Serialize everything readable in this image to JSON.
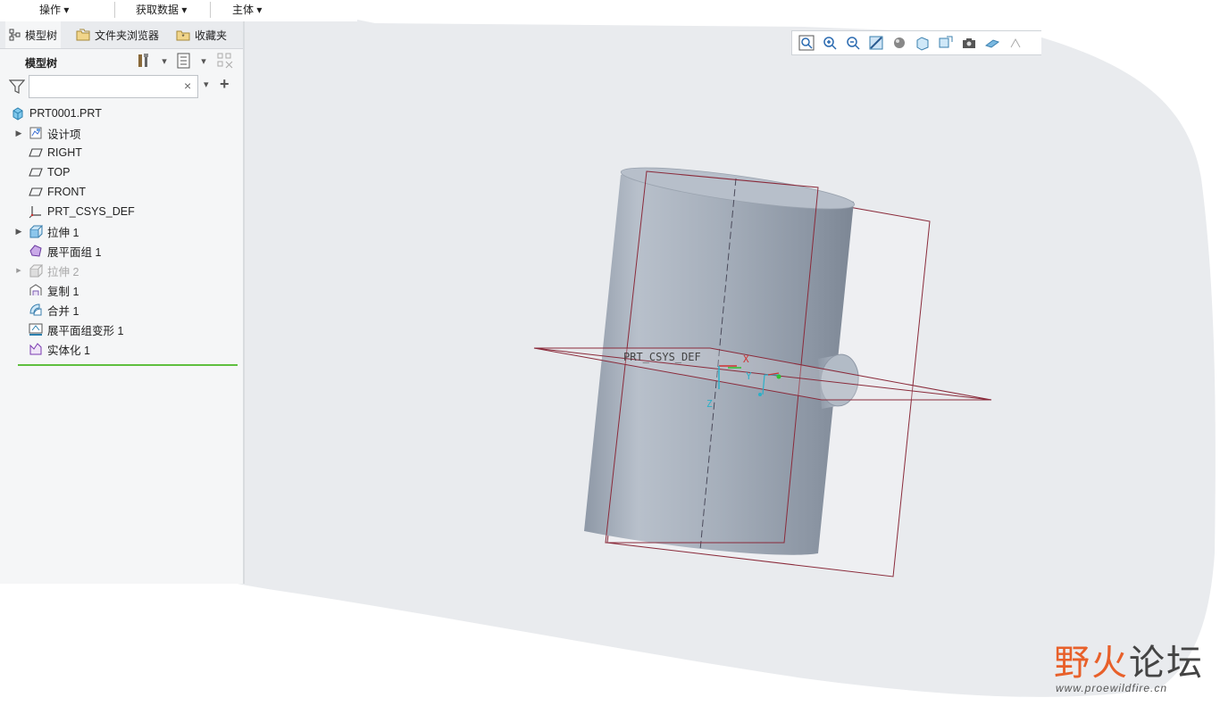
{
  "ribbon": {
    "items": [
      "操作 ▾",
      "获取数据 ▾",
      "主体 ▾"
    ]
  },
  "tabs": [
    {
      "label": "模型树",
      "icon": "model-tree-icon"
    },
    {
      "label": "文件夹浏览器",
      "icon": "folder-browser-icon"
    },
    {
      "label": "收藏夹",
      "icon": "favorites-icon"
    }
  ],
  "tree_header": {
    "title": "模型树"
  },
  "search": {
    "value": "",
    "clear": "×"
  },
  "tree": {
    "items": [
      {
        "label": "PRT0001.PRT",
        "icon": "part-icon",
        "expandable": false,
        "dim": false
      },
      {
        "label": "设计项",
        "icon": "design-items-icon",
        "expandable": true,
        "dim": false
      },
      {
        "label": "RIGHT",
        "icon": "datum-plane-icon",
        "expandable": false,
        "dim": false
      },
      {
        "label": "TOP",
        "icon": "datum-plane-icon",
        "expandable": false,
        "dim": false
      },
      {
        "label": "FRONT",
        "icon": "datum-plane-icon",
        "expandable": false,
        "dim": false
      },
      {
        "label": "PRT_CSYS_DEF",
        "icon": "csys-icon",
        "expandable": false,
        "dim": false
      },
      {
        "label": "拉伸 1",
        "icon": "extrude-icon",
        "expandable": true,
        "dim": false
      },
      {
        "label": "展平面组 1",
        "icon": "flatten-quilt-icon",
        "expandable": false,
        "dim": false
      },
      {
        "label": "拉伸 2",
        "icon": "extrude-icon",
        "expandable": true,
        "dim": true
      },
      {
        "label": "复制 1",
        "icon": "copy-icon",
        "expandable": false,
        "dim": false
      },
      {
        "label": "合并 1",
        "icon": "merge-icon",
        "expandable": false,
        "dim": false
      },
      {
        "label": "展平面组变形 1",
        "icon": "flatten-deform-icon",
        "expandable": false,
        "dim": false
      },
      {
        "label": "实体化 1",
        "icon": "solidify-icon",
        "expandable": false,
        "dim": false
      }
    ]
  },
  "viewport": {
    "csys_label": "PRT_CSYS_DEF",
    "axis_x": "X",
    "axis_y": "Y",
    "axis_z": "Z"
  },
  "watermark": {
    "cn_part1": "野",
    "cn_part2": "火",
    "cn_part3": "论坛",
    "url": "www.proewildfire.cn"
  },
  "colors": {
    "viewport_bg": "#e9ebee",
    "model_body": "#a3adb8",
    "datum_plane": "#8a2a3a",
    "tree_end_line": "#5fbf3f",
    "watermark_fire": "#e8602a"
  }
}
